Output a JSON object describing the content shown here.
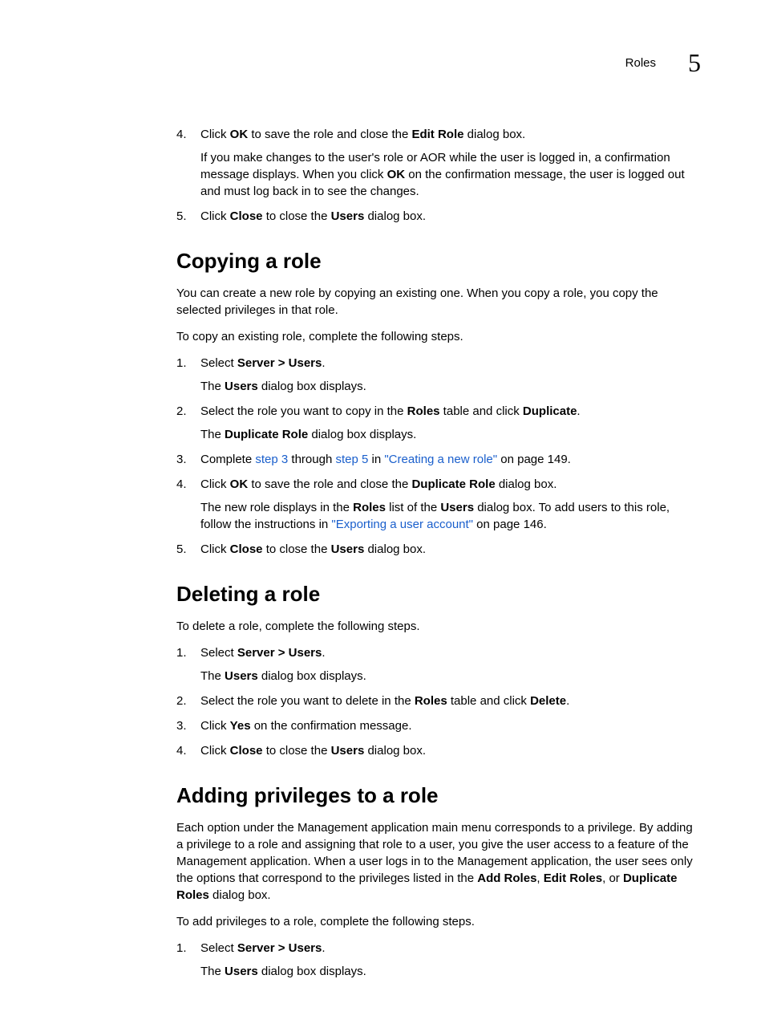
{
  "header": {
    "label": "Roles",
    "chapter": "5"
  },
  "intro_steps_start": 4,
  "intro_steps": [
    {
      "parts": [
        {
          "t": "Click "
        },
        {
          "t": "OK",
          "b": true
        },
        {
          "t": " to save the role and close the "
        },
        {
          "t": "Edit Role",
          "b": true
        },
        {
          "t": " dialog box."
        }
      ],
      "sub": [
        {
          "t": "If you make changes to the user's role or AOR while the user is logged in, a confirmation message displays. When you click "
        },
        {
          "t": "OK",
          "b": true
        },
        {
          "t": " on the confirmation message, the user is logged out and must log back in to see the changes."
        }
      ]
    },
    {
      "parts": [
        {
          "t": "Click "
        },
        {
          "t": "Close",
          "b": true
        },
        {
          "t": " to close the "
        },
        {
          "t": "Users",
          "b": true
        },
        {
          "t": " dialog box."
        }
      ]
    }
  ],
  "sections": [
    {
      "title": "Copying a role",
      "paras": [
        [
          {
            "t": "You can create a new role by copying an existing one. When you copy a role, you copy the selected privileges in that role."
          }
        ],
        [
          {
            "t": "To copy an existing role, complete the following steps."
          }
        ]
      ],
      "steps": [
        {
          "parts": [
            {
              "t": "Select "
            },
            {
              "t": "Server > Users",
              "b": true
            },
            {
              "t": "."
            }
          ],
          "sub": [
            {
              "t": "The "
            },
            {
              "t": "Users",
              "b": true
            },
            {
              "t": " dialog box displays."
            }
          ]
        },
        {
          "parts": [
            {
              "t": "Select the role you want to copy in the "
            },
            {
              "t": "Roles",
              "b": true
            },
            {
              "t": " table and click "
            },
            {
              "t": "Duplicate",
              "b": true
            },
            {
              "t": "."
            }
          ],
          "sub": [
            {
              "t": "The "
            },
            {
              "t": "Duplicate Role",
              "b": true
            },
            {
              "t": " dialog box displays."
            }
          ]
        },
        {
          "parts": [
            {
              "t": "Complete "
            },
            {
              "t": "step 3",
              "link": true
            },
            {
              "t": " through "
            },
            {
              "t": "step 5",
              "link": true
            },
            {
              "t": " in "
            },
            {
              "t": "\"Creating a new role\"",
              "link": true
            },
            {
              "t": " on page 149."
            }
          ]
        },
        {
          "parts": [
            {
              "t": "Click "
            },
            {
              "t": "OK",
              "b": true
            },
            {
              "t": " to save the role and close the "
            },
            {
              "t": "Duplicate Role",
              "b": true
            },
            {
              "t": " dialog box."
            }
          ],
          "sub": [
            {
              "t": "The new role displays in the "
            },
            {
              "t": "Roles",
              "b": true
            },
            {
              "t": " list of the "
            },
            {
              "t": "Users",
              "b": true
            },
            {
              "t": " dialog box. To add users to this role, follow the instructions in "
            },
            {
              "t": "\"Exporting a user account\"",
              "link": true
            },
            {
              "t": " on page 146."
            }
          ]
        },
        {
          "parts": [
            {
              "t": "Click "
            },
            {
              "t": "Close",
              "b": true
            },
            {
              "t": " to close the "
            },
            {
              "t": "Users",
              "b": true
            },
            {
              "t": " dialog box."
            }
          ]
        }
      ]
    },
    {
      "title": "Deleting a role",
      "paras": [
        [
          {
            "t": "To delete a role, complete the following steps."
          }
        ]
      ],
      "steps": [
        {
          "parts": [
            {
              "t": "Select "
            },
            {
              "t": "Server > Users",
              "b": true
            },
            {
              "t": "."
            }
          ],
          "sub": [
            {
              "t": "The "
            },
            {
              "t": "Users",
              "b": true
            },
            {
              "t": " dialog box displays."
            }
          ]
        },
        {
          "parts": [
            {
              "t": "Select the role you want to delete in the "
            },
            {
              "t": "Roles",
              "b": true
            },
            {
              "t": " table and click "
            },
            {
              "t": "Delete",
              "b": true
            },
            {
              "t": "."
            }
          ]
        },
        {
          "parts": [
            {
              "t": "Click "
            },
            {
              "t": "Yes",
              "b": true
            },
            {
              "t": " on the confirmation message."
            }
          ]
        },
        {
          "parts": [
            {
              "t": "Click "
            },
            {
              "t": "Close",
              "b": true
            },
            {
              "t": " to close the "
            },
            {
              "t": "Users",
              "b": true
            },
            {
              "t": " dialog box."
            }
          ]
        }
      ]
    },
    {
      "title": "Adding privileges to a role",
      "paras": [
        [
          {
            "t": "Each option under the Management application main menu corresponds to a privilege. By adding a privilege to a role and assigning that role to a user, you give the user access to a feature of the Management application. When a user logs in to the Management application, the user sees only the options that correspond to the privileges listed in the "
          },
          {
            "t": "Add Roles",
            "b": true
          },
          {
            "t": ", "
          },
          {
            "t": "Edit Roles",
            "b": true
          },
          {
            "t": ", or "
          },
          {
            "t": "Duplicate Roles",
            "b": true
          },
          {
            "t": " dialog box."
          }
        ],
        [
          {
            "t": "To add privileges to a role, complete the following steps."
          }
        ]
      ],
      "steps": [
        {
          "parts": [
            {
              "t": "Select "
            },
            {
              "t": "Server > Users",
              "b": true
            },
            {
              "t": "."
            }
          ],
          "sub": [
            {
              "t": "The "
            },
            {
              "t": "Users",
              "b": true
            },
            {
              "t": " dialog box displays."
            }
          ]
        }
      ]
    }
  ]
}
